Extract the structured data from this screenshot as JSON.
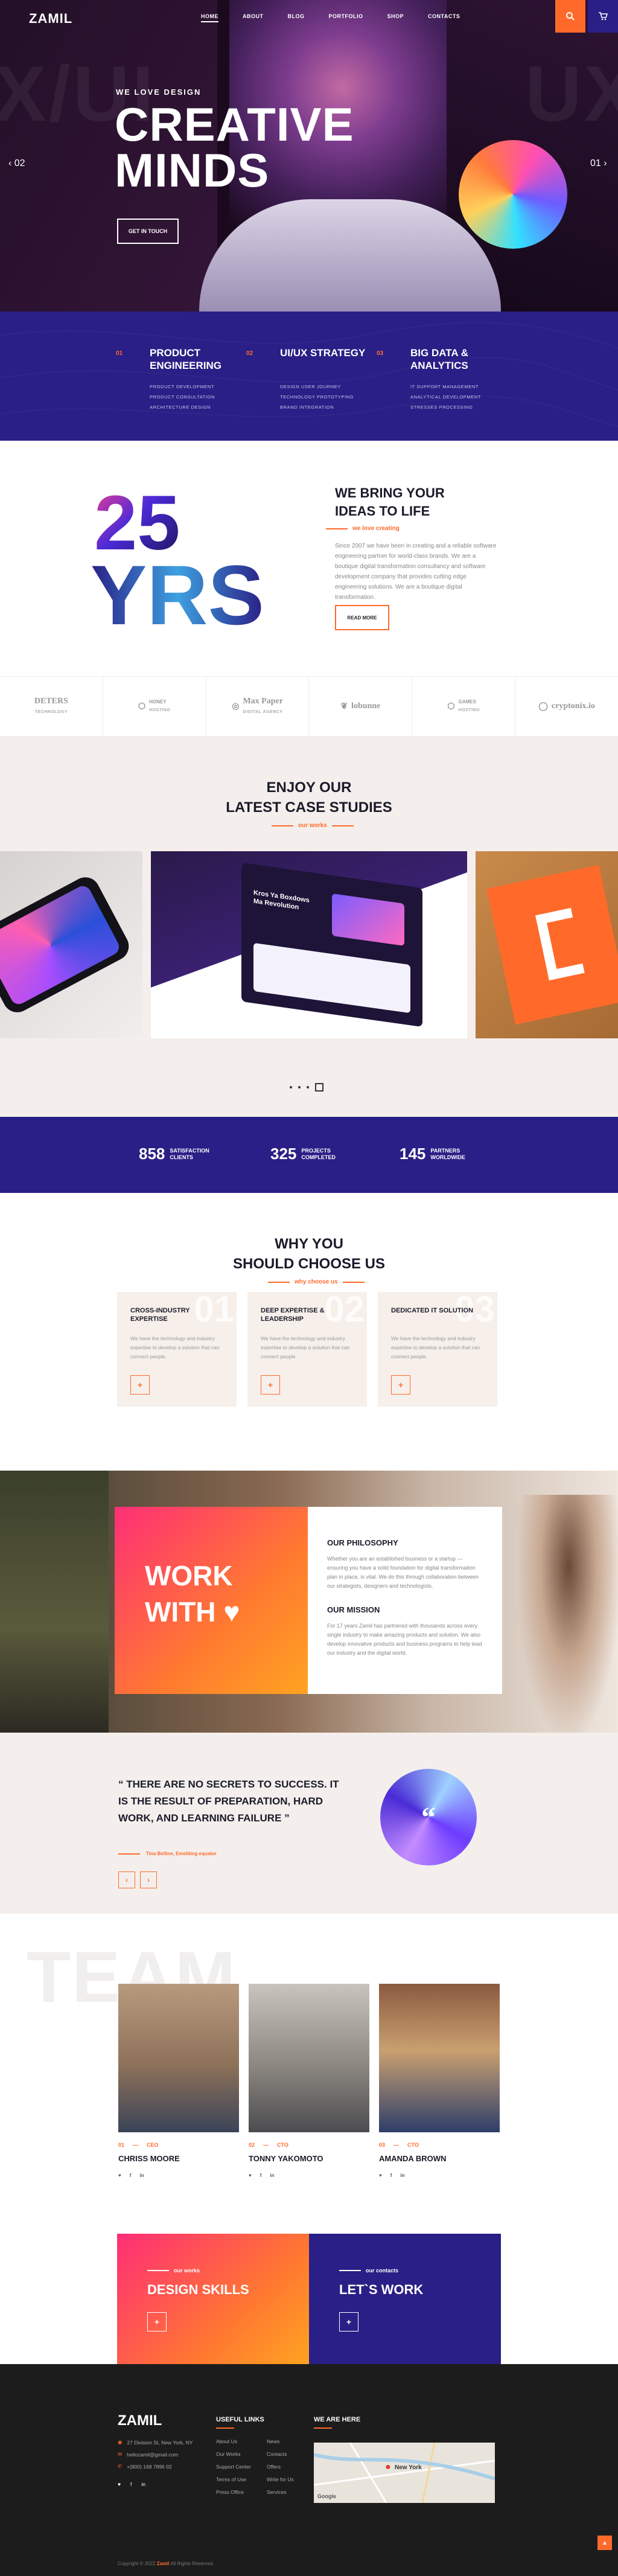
{
  "header": {
    "logo": "ZAMIL",
    "nav": [
      "HOME",
      "ABOUT",
      "BLOG",
      "PORTFOLIO",
      "SHOP",
      "CONTACTS"
    ],
    "active_indicator": "—"
  },
  "hero": {
    "ghost_left": "X/UI",
    "ghost_right": "UX",
    "subtitle": "WE LOVE DESIGN",
    "title_line1": "CREATIVE",
    "title_line2": "MINDS",
    "button": "GET IN TOUCH",
    "prev": "02",
    "next": "01",
    "prev_arrow": "‹",
    "next_arrow": "›"
  },
  "services": [
    {
      "num": "01",
      "title": "PRODUCT ENGINEERING",
      "items": [
        "PRODUCT DEVELOPMENT",
        "PRODUCT CONSULTATION",
        "ARCHITECTURE DESIGN"
      ]
    },
    {
      "num": "02",
      "title": "UI/UX STRATEGY",
      "items": [
        "DESIGN USER JOURNEY",
        "TECHNOLOGY PROTOTYPING",
        "BRAND INTEGRATION"
      ]
    },
    {
      "num": "03",
      "title": "BIG DATA & ANALYTICS",
      "items": [
        "IT SUPPORT MANAGEMENT",
        "ANALYTICAL DEVELOPMENT",
        "STRESSES PROCESSING"
      ]
    }
  ],
  "about": {
    "num": "25",
    "yrs": "YRS",
    "title_line1": "WE BRING YOUR",
    "title_line2": "IDEAS TO LIFE",
    "tagline": "we love creating",
    "paragraph": "Since 2007 we have been in creating and a reliable software engineering partner for world-class brands. We are a boutique digital transformation consultancy and software development company that provides cutting edge engineering solutions. We are a boutique digital transformation.",
    "button": "READ MORE"
  },
  "brands": [
    {
      "name": "DETERS",
      "sub": "TECHNOLOGY"
    },
    {
      "name": "HONEY",
      "sub": "HOSTING"
    },
    {
      "name": "Max Paper",
      "sub": "DIGITAL AGENCY"
    },
    {
      "name": "lobunne",
      "sub": ""
    },
    {
      "name": "GAMES",
      "sub": "HOSTING"
    },
    {
      "name": "cryptonix.io",
      "sub": ""
    }
  ],
  "cases": {
    "title_line1": "ENJOY OUR",
    "title_line2": "LATEST CASE STUDIES",
    "tagline": "our works",
    "mock_title": "Kros Ya Boxdows Ma Revolution"
  },
  "stats": [
    {
      "value": "858",
      "label": "SATISFACTION CLIENTS"
    },
    {
      "value": "325",
      "label": "PROJECTS COMPLETED"
    },
    {
      "value": "145",
      "label": "PARTNERS WORLDWIDE"
    }
  ],
  "why": {
    "title_line1": "WHY YOU",
    "title_line2": "SHOULD CHOOSE US",
    "tagline": "why choose us",
    "cards": [
      {
        "num": "01",
        "title": "CROSS-INDUSTRY EXPERTISE",
        "desc": "We have the technology and industry expertise to develop a solution that can connect people.",
        "btn": "+"
      },
      {
        "num": "02",
        "title": "DEEP EXPERTISE & LEADERSHIP",
        "desc": "We have the technology and industry expertise to develop a solution that can connect people.",
        "btn": "+"
      },
      {
        "num": "03",
        "title": "DEDICATED IT SOLUTION",
        "desc": "We have the technology and industry expertise to develop a solution that can connect people.",
        "btn": "+"
      }
    ]
  },
  "philosophy": {
    "work_line1": "WORK",
    "work_line2": "WITH ♥",
    "h1": "OUR PHILOSOPHY",
    "p1": "Whether you are an established business or a startup — ensuring you have a solid foundation for digital transformation plan in place, is vital. We do this through collaboration between our strategists, designers and technologists.",
    "h2": "OUR MISSION",
    "p2": "For 17 years Zamil has partnered with thousands across every single industry to make amazing products and solution. We also develop innovative products and business programs to help lead our industry and the digital world."
  },
  "quote": {
    "text": "“ THERE ARE NO SECRETS TO SUCCESS. IT IS THE RESULT OF PREPARATION, HARD WORK, AND LEARNING FAILURE ”",
    "author": "Tina Belline, Emeliting equator",
    "prev": "‹",
    "next": "›",
    "quote_mark": "“"
  },
  "team": {
    "ghost": "TEAM",
    "members": [
      {
        "num": "01",
        "role": "CEO",
        "name": "CHRISS MOORE"
      },
      {
        "num": "02",
        "role": "CTO",
        "name": "TONNY YAKOMOTO"
      },
      {
        "num": "03",
        "role": "CTO",
        "name": "AMANDA BROWN"
      }
    ],
    "socials": [
      "♥",
      "f",
      "in"
    ]
  },
  "cta": {
    "left_label": "our works",
    "left_title": "DESIGN SKILLS",
    "right_label": "our contacts",
    "right_title": "LET`S WORK",
    "btn": "+"
  },
  "footer": {
    "logo": "ZAMIL",
    "address": "27 Division St, New York, NY",
    "email": "hellozamil@gmail.com",
    "phone": "+(800) 168 7896 02",
    "useful_links_title": "USEFUL LINKS",
    "links_col1": [
      "About Us",
      "Our Works",
      "Support Center",
      "Terms of Use",
      "Press Office"
    ],
    "links_col2": [
      "News",
      "Contacts",
      "Offers",
      "Write for Us",
      "Services"
    ],
    "we_are_here_title": "WE ARE HERE",
    "map_label": "New York",
    "map_brand": "Google",
    "copyright_prefix": "Copyright © 2022",
    "copyright_brand": "Zamil",
    "copyright_suffix": "All Rights Reserved.",
    "to_top": "▲"
  },
  "colors": {
    "accent": "#ff6a2b",
    "primary": "#2a1f86",
    "dark": "#1c1c1c"
  }
}
